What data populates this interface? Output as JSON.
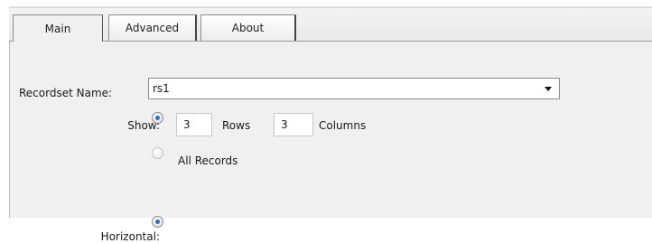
{
  "tabs": [
    {
      "label": "Main",
      "active": true
    },
    {
      "label": "Advanced",
      "active": false
    },
    {
      "label": "About",
      "active": false
    }
  ],
  "recordset": {
    "label": "Recordset Name:",
    "value": "rs1"
  },
  "show": {
    "label": "Show:",
    "option_limited": {
      "selected": true,
      "rows_value": "3",
      "rows_label": "Rows",
      "columns_value": "3",
      "columns_label": "Columns"
    },
    "option_all": {
      "selected": false,
      "label": "All Records"
    }
  },
  "horizontal": {
    "label": "Horizontal:",
    "selected": true
  },
  "colors": {
    "accent": "#2b6fb7",
    "panel": "#f0f0f0"
  }
}
